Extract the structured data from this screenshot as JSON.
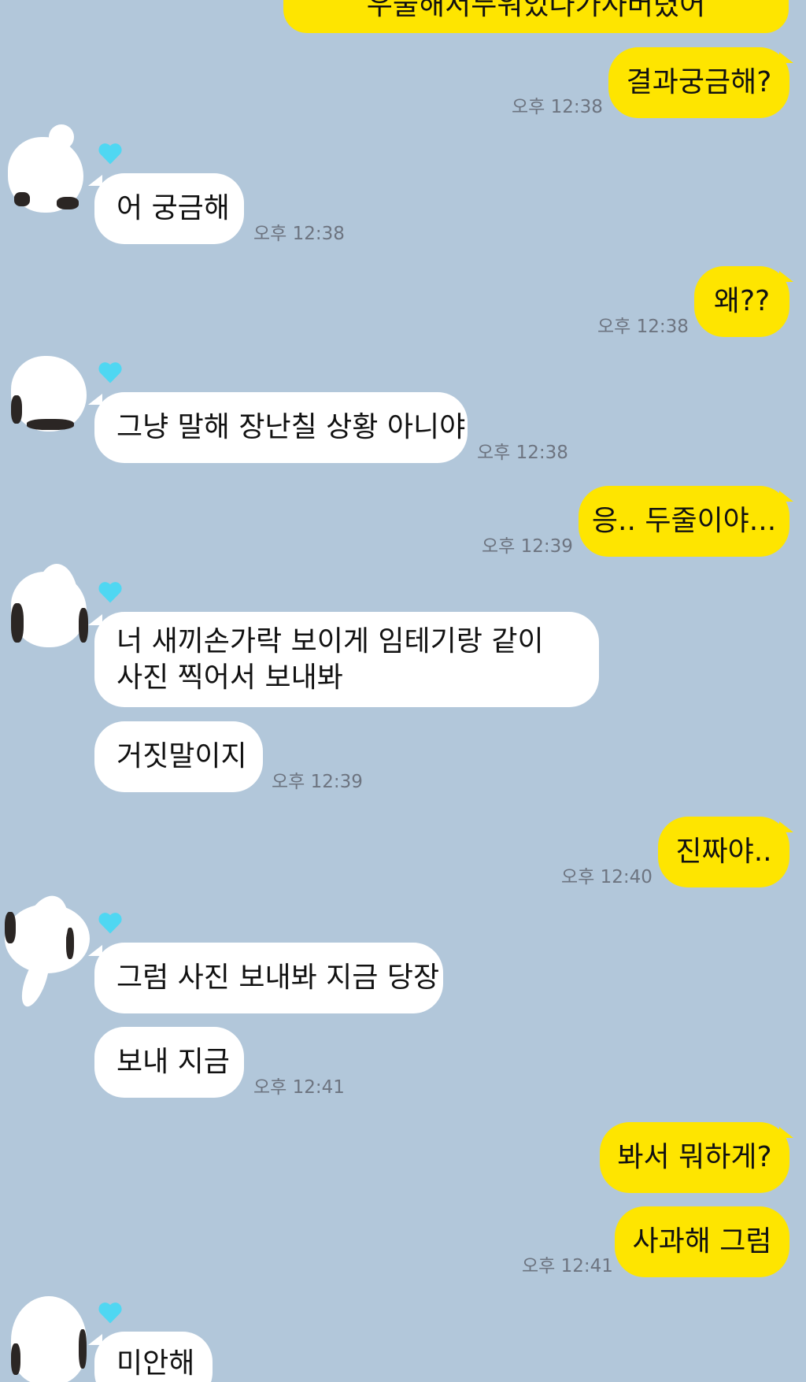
{
  "accent": {
    "outgoing_bubble": "#fee500",
    "incoming_bubble": "#ffffff",
    "background": "#b2c7da",
    "heart": "#4fd7f2"
  },
  "messages": {
    "m0": {
      "text": "우울해서두워있나가사버렸어"
    },
    "m1": {
      "text": "결과궁금해?",
      "time": "오후 12:38"
    },
    "m2": {
      "text": "어 궁금해",
      "time": "오후 12:38"
    },
    "m3": {
      "text": "왜??",
      "time": "오후 12:38"
    },
    "m4": {
      "text": "그냥 말해 장난칠 상황 아니야",
      "time": "오후 12:38"
    },
    "m5": {
      "text": "응.. 두줄이야...",
      "time": "오후 12:39"
    },
    "m6": {
      "line1": "너 새끼손가락 보이게 임테기랑 같이",
      "line2": "사진 찍어서 보내봐"
    },
    "m7": {
      "text": "거짓말이지",
      "time": "오후 12:39"
    },
    "m8": {
      "text": "진짜야..",
      "time": "오후 12:40"
    },
    "m9": {
      "text": "그럼 사진 보내봐 지금 당장"
    },
    "m10": {
      "text": "보내 지금",
      "time": "오후 12:41"
    },
    "m11": {
      "text": "봐서 뭐하게?"
    },
    "m12": {
      "text": "사과해 그럼",
      "time": "오후 12:41"
    },
    "m13": {
      "text": "미안해"
    }
  },
  "sender_icon": "heart-icon"
}
